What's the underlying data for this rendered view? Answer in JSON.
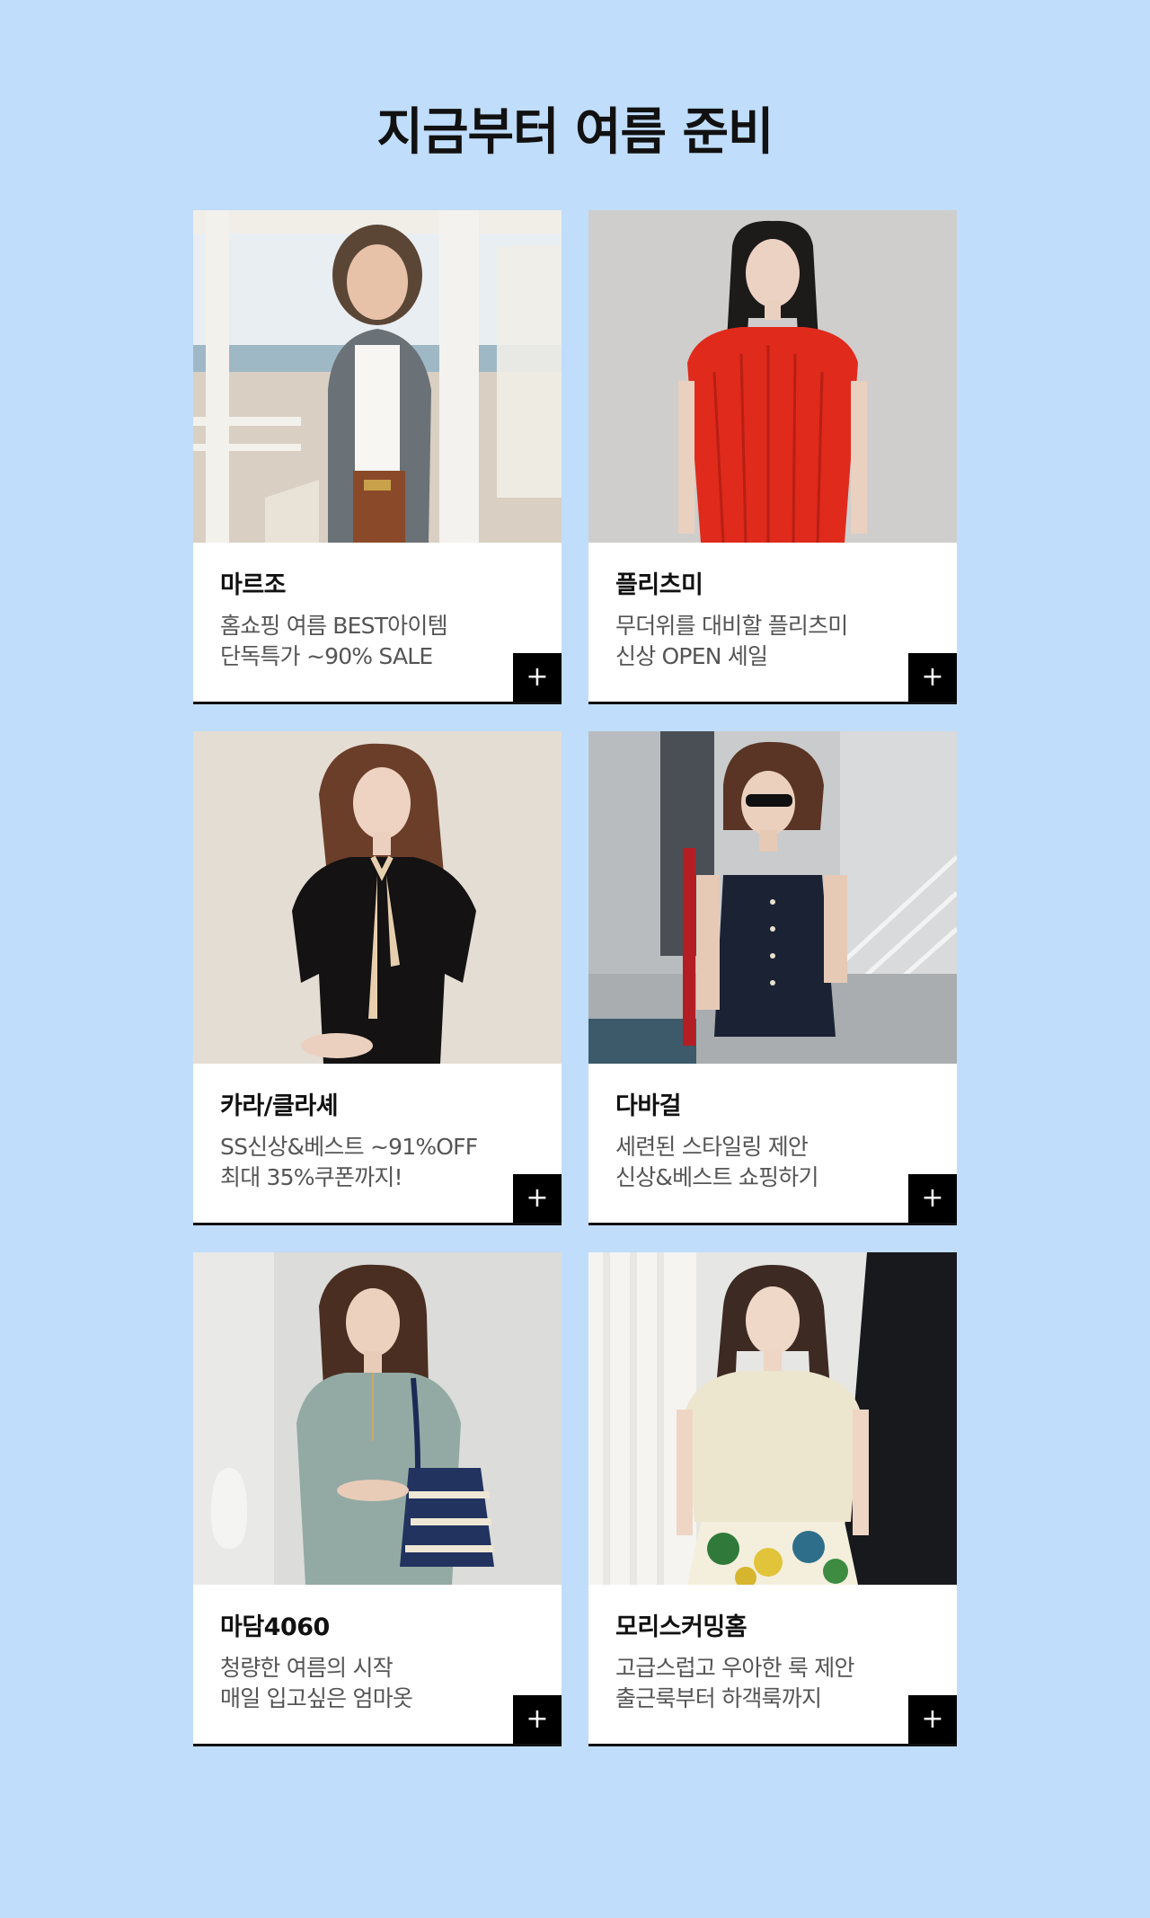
{
  "title": "지금부터 여름 준비",
  "plus_icon": "+",
  "cards": [
    {
      "brand": "마르조",
      "line1": "홈쇼핑 여름 BEST아이템",
      "line2": "단독특가 ~90% SALE"
    },
    {
      "brand": "플리츠미",
      "line1": "무더위를 대비할 플리츠미",
      "line2": "신상 OPEN 세일"
    },
    {
      "brand": "카라/클라셰",
      "line1": "SS신상&베스트 ~91%OFF",
      "line2": "최대 35%쿠폰까지!"
    },
    {
      "brand": "다바걸",
      "line1": "세련된 스타일링 제안",
      "line2": "신상&베스트 쇼핑하기"
    },
    {
      "brand": "마담4060",
      "line1": "청량한 여름의 시작",
      "line2": "매일 입고싶은 엄마옷"
    },
    {
      "brand": "모리스커밍홈",
      "line1": "고급스럽고 우아한 룩 제안",
      "line2": "출근룩부터 하객룩까지"
    }
  ]
}
